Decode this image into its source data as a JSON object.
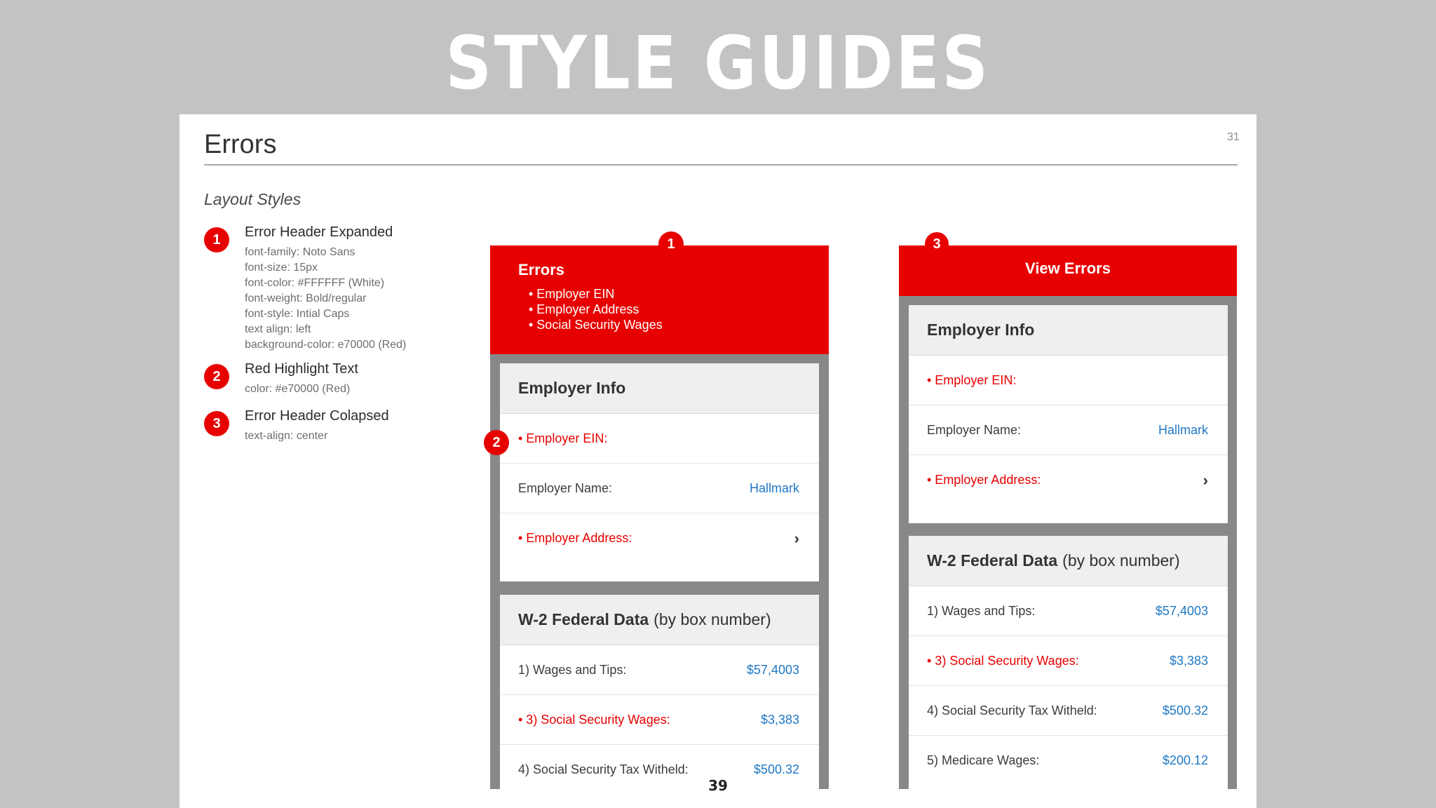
{
  "banner_title": "STYLE GUIDES",
  "slide": {
    "title": "Errors",
    "page_number": "31",
    "section_title": "Layout Styles",
    "legend": [
      {
        "number": "1",
        "label": "Error Header Expanded",
        "specs": [
          "font-family:  Noto Sans",
          "font-size:  15px",
          "font-color:  #FFFFFF (White)",
          "font-weight:  Bold/regular",
          "font-style:  Intial Caps",
          "text align: left",
          "background-color:  e70000 (Red)"
        ]
      },
      {
        "number": "2",
        "label": "Red Highlight Text",
        "specs": [
          "color: #e70000 (Red)"
        ]
      },
      {
        "number": "3",
        "label": "Error Header Colapsed",
        "specs": [
          "text-align: center"
        ]
      }
    ]
  },
  "mock_expanded": {
    "badge_header": "1",
    "badge_row": "2",
    "header_title": "Errors",
    "error_items": [
      "• Employer EIN",
      "• Employer Address",
      "• Social Security Wages"
    ],
    "employer_card": {
      "title": "Employer Info",
      "rows": [
        {
          "label": "• Employer EIN:",
          "value": ""
        },
        {
          "label": "Employer Name:",
          "value": "Hallmark"
        },
        {
          "label": "• Employer Address:",
          "value": "›"
        }
      ]
    },
    "w2_card": {
      "title_bold": "W-2 Federal Data",
      "title_normal": "(by box number)",
      "rows": [
        {
          "label": "1) Wages and Tips:",
          "value": "$57,4003"
        },
        {
          "label": "• 3) Social Security Wages:",
          "value": "$3,383"
        },
        {
          "label": "4) Social Security Tax Witheld:",
          "value": "$500.32"
        }
      ]
    }
  },
  "mock_collapsed": {
    "badge_header": "3",
    "header_title": "View Errors",
    "employer_card": {
      "title": "Employer Info",
      "rows": [
        {
          "label": "• Employer EIN:",
          "value": ""
        },
        {
          "label": "Employer Name:",
          "value": "Hallmark"
        },
        {
          "label": "• Employer Address:",
          "value": "›"
        }
      ]
    },
    "w2_card": {
      "title_bold": "W-2 Federal Data",
      "title_normal": "(by box number)",
      "rows": [
        {
          "label": "1) Wages and Tips:",
          "value": "$57,4003"
        },
        {
          "label": "• 3) Social Security Wages:",
          "value": "$3,383"
        },
        {
          "label": "4) Social Security Tax Witheld:",
          "value": "$500.32"
        },
        {
          "label": "5) Medicare Wages:",
          "value": "$200.12"
        }
      ]
    }
  },
  "footer_page": "39",
  "colors": {
    "error_red": "#e70000",
    "link_blue": "#1f77c4",
    "banner_gray": "#c3c3c3"
  }
}
